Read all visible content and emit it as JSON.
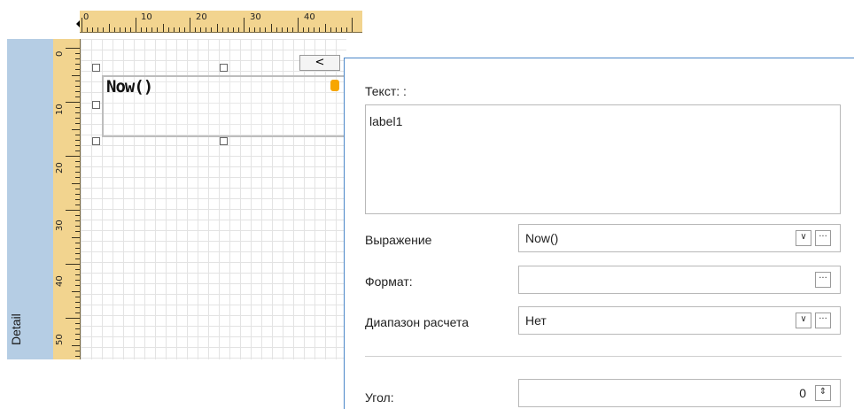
{
  "ruler": {
    "h_labels": [
      "0",
      "10",
      "20",
      "30",
      "40"
    ],
    "v_labels": [
      "0",
      "10",
      "20",
      "30",
      "40",
      "50"
    ]
  },
  "band": {
    "label": "Detail"
  },
  "design": {
    "label_text": "Now()",
    "collapse_glyph": "<"
  },
  "props": {
    "text_label": "Текст: :",
    "text_value": "label1",
    "expression_label": "Выражение",
    "expression_value": "Now()",
    "format_label": "Формат:",
    "format_value": "",
    "range_label": "Диапазон расчета",
    "range_value": "Нет",
    "angle_label": "Угол:",
    "angle_value": "0",
    "ellipsis": "···",
    "dropdown_glyph": "∨",
    "spin_glyph": "⇕"
  },
  "colors": {
    "ruler": "#f2d48f",
    "band": "#b5cde4",
    "accent": "#4a86c8",
    "db_icon": "#f7a600"
  }
}
